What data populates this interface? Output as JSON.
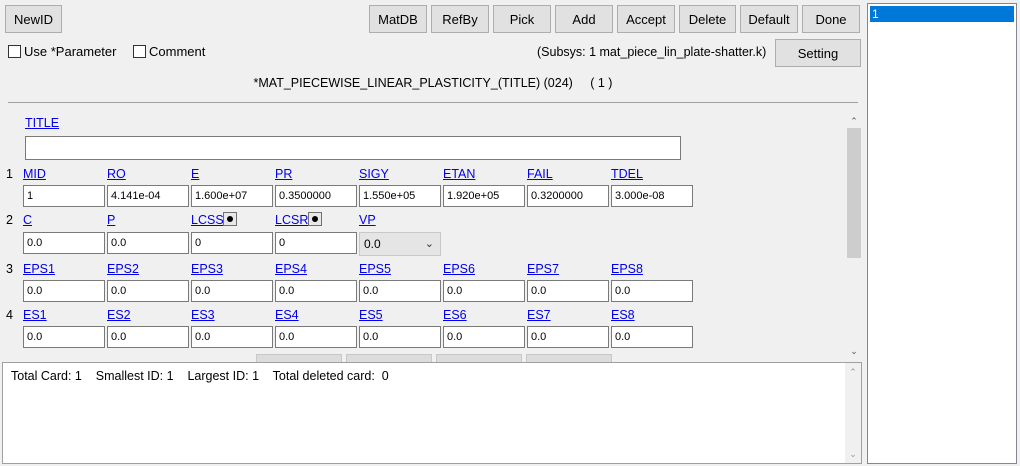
{
  "toolbar": {
    "newid": "NewID",
    "matdb": "MatDB",
    "refby": "RefBy",
    "pick": "Pick",
    "add": "Add",
    "accept": "Accept",
    "delete": "Delete",
    "default": "Default",
    "done": "Done",
    "setting": "Setting"
  },
  "options": {
    "use_parameter": "Use *Parameter",
    "comment": "Comment"
  },
  "subsys": "(Subsys: 1 mat_piece_lin_plate-shatter.k)",
  "keyword_title": "*MAT_PIECEWISE_LINEAR_PLASTICITY_(TITLE) (024)",
  "keyword_count": "( 1 )",
  "title_label": "TITLE",
  "cards": [
    {
      "num": "1",
      "labels": [
        "MID",
        "RO",
        "E",
        "PR",
        "SIGY",
        "ETAN",
        "FAIL",
        "TDEL"
      ],
      "values": [
        "1",
        "4.141e-04",
        "1.600e+07",
        "0.3500000",
        "1.550e+05",
        "1.920e+05",
        "0.3200000",
        "3.000e-08"
      ]
    },
    {
      "num": "2",
      "labels": [
        "C",
        "P",
        "LCSS",
        "LCSR",
        "VP"
      ],
      "values": [
        "0.0",
        "0.0",
        "0",
        "0",
        "0.0"
      ]
    },
    {
      "num": "3",
      "labels": [
        "EPS1",
        "EPS2",
        "EPS3",
        "EPS4",
        "EPS5",
        "EPS6",
        "EPS7",
        "EPS8"
      ],
      "values": [
        "0.0",
        "0.0",
        "0.0",
        "0.0",
        "0.0",
        "0.0",
        "0.0",
        "0.0"
      ]
    },
    {
      "num": "4",
      "labels": [
        "ES1",
        "ES2",
        "ES3",
        "ES4",
        "ES5",
        "ES6",
        "ES7",
        "ES8"
      ],
      "values": [
        "0.0",
        "0.0",
        "0.0",
        "0.0",
        "0.0",
        "0.0",
        "0.0",
        "0.0"
      ]
    }
  ],
  "status": "Total Card: 1    Smallest ID: 1    Largest ID: 1    Total deleted card:  0",
  "id_list": [
    "1"
  ],
  "colors": {
    "selection": "#0078d7",
    "link": "#0000ee"
  }
}
